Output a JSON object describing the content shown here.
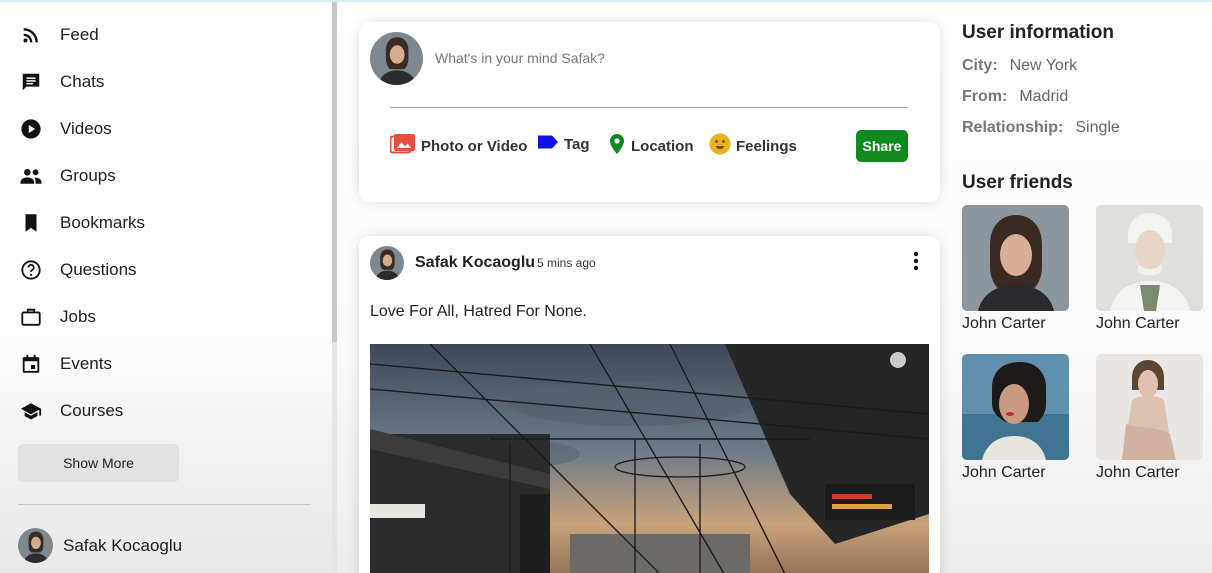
{
  "sidebar": {
    "items": [
      {
        "label": "Feed",
        "icon": "rss-feed-icon"
      },
      {
        "label": "Chats",
        "icon": "chat-icon"
      },
      {
        "label": "Videos",
        "icon": "play-circle-icon"
      },
      {
        "label": "Groups",
        "icon": "group-icon"
      },
      {
        "label": "Bookmarks",
        "icon": "bookmark-icon"
      },
      {
        "label": "Questions",
        "icon": "help-circle-icon"
      },
      {
        "label": "Jobs",
        "icon": "briefcase-icon"
      },
      {
        "label": "Events",
        "icon": "calendar-icon"
      },
      {
        "label": "Courses",
        "icon": "school-icon"
      }
    ],
    "show_more": "Show More",
    "user_name": "Safak Kocaoglu"
  },
  "share": {
    "placeholder": "What's in your mind Safak?",
    "options": [
      {
        "label": "Photo or Video",
        "icon": "photo-library-icon",
        "color": "#e74c3c"
      },
      {
        "label": "Tag",
        "icon": "label-icon",
        "color": "#1010e8"
      },
      {
        "label": "Location",
        "icon": "location-pin-icon",
        "color": "#0e8a1f"
      },
      {
        "label": "Feelings",
        "icon": "smiley-icon",
        "color": "#e6b31e"
      }
    ],
    "button": "Share",
    "button_color": "#0e8a1f"
  },
  "post": {
    "author": "Safak Kocaoglu",
    "time": "5 mins ago",
    "text": "Love For All, Hatred For None."
  },
  "rightbar": {
    "info_title": "User information",
    "info": [
      {
        "key": "City:",
        "value": "New York"
      },
      {
        "key": "From:",
        "value": "Madrid"
      },
      {
        "key": "Relationship:",
        "value": "Single"
      }
    ],
    "friends_title": "User friends",
    "friends": [
      {
        "name": "John Carter"
      },
      {
        "name": "John Carter"
      },
      {
        "name": "John Carter"
      },
      {
        "name": "John Carter"
      }
    ]
  }
}
